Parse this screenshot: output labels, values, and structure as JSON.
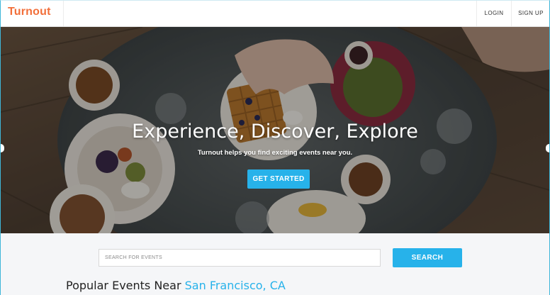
{
  "navbar": {
    "logo": "Turnout",
    "login_label": "LOGIN",
    "signup_label": "SIGN UP"
  },
  "hero": {
    "title": "Experience, Discover, Explore",
    "subtitle": "Turnout helps you find exciting events near you.",
    "cta_label": "GET STARTED"
  },
  "search": {
    "placeholder": "SEARCH FOR EVENTS",
    "button_label": "SEARCH"
  },
  "popular": {
    "prefix": "Popular Events Near ",
    "location": "San Francisco, CA"
  },
  "colors": {
    "brand": "#f26f3a",
    "accent": "#27b2ea"
  }
}
